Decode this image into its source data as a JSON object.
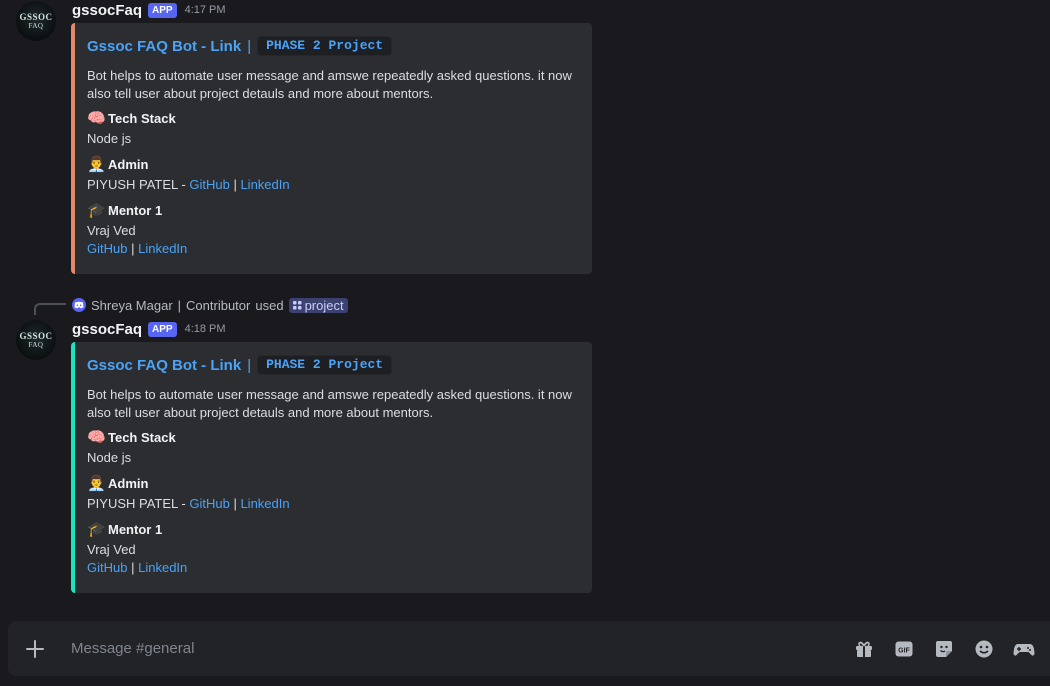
{
  "messages": [
    {
      "username": "gssocFaq",
      "badge": "APP",
      "time": "4:17 PM",
      "avatar_text_1": "GSSOC",
      "avatar_text_2": "FAQ",
      "embed": {
        "title": "Gssoc FAQ Bot - Link",
        "separator": "|",
        "tag": "PHASE 2 Project",
        "description": "Bot helps to automate user message and amswe repeatedly asked questions. it now also tell user about project detauls and more about mentors.",
        "fields": {
          "tech": {
            "emoji": "🧠",
            "name": "Tech Stack",
            "value": "Node js"
          },
          "admin": {
            "emoji": "👨‍💼",
            "name": "Admin",
            "person": "PIYUSH PATEL - ",
            "link1": "GitHub",
            "pipe": "|",
            "link2": "LinkedIn"
          },
          "mentor": {
            "emoji": "🎓",
            "name": "Mentor 1",
            "person": "Vraj Ved",
            "link1": "GitHub",
            "pipe": "|",
            "link2": "LinkedIn"
          }
        },
        "accent": "#e08a66"
      }
    },
    {
      "username": "gssocFaq",
      "badge": "APP",
      "time": "4:18 PM",
      "avatar_text_1": "GSSOC",
      "avatar_text_2": "FAQ",
      "reply": {
        "user": "Shreya Magar",
        "role": "Contributor",
        "pipe": "|",
        "used": "used",
        "command": "project"
      },
      "embed": {
        "title": "Gssoc FAQ Bot - Link",
        "separator": "|",
        "tag": "PHASE 2 Project",
        "description": "Bot helps to automate user message and amswe repeatedly asked questions. it now also tell user about project detauls and more about mentors.",
        "fields": {
          "tech": {
            "emoji": "🧠",
            "name": "Tech Stack",
            "value": "Node js"
          },
          "admin": {
            "emoji": "👨‍💼",
            "name": "Admin",
            "person": "PIYUSH PATEL - ",
            "link1": "GitHub",
            "pipe": "|",
            "link2": "LinkedIn"
          },
          "mentor": {
            "emoji": "🎓",
            "name": "Mentor 1",
            "person": "Vraj Ved",
            "link1": "GitHub",
            "pipe": "|",
            "link2": "LinkedIn"
          }
        },
        "accent": "#19e6c1"
      }
    }
  ],
  "composer": {
    "placeholder": "Message #general",
    "icons": [
      "gift-icon",
      "gif-icon",
      "sticker-icon",
      "emoji-icon",
      "controller-icon"
    ]
  },
  "colors": {
    "background": "#1a1a1e",
    "embed_bg": "#2b2d31",
    "link": "#4aa3f7",
    "app_badge": "#5865f2"
  }
}
